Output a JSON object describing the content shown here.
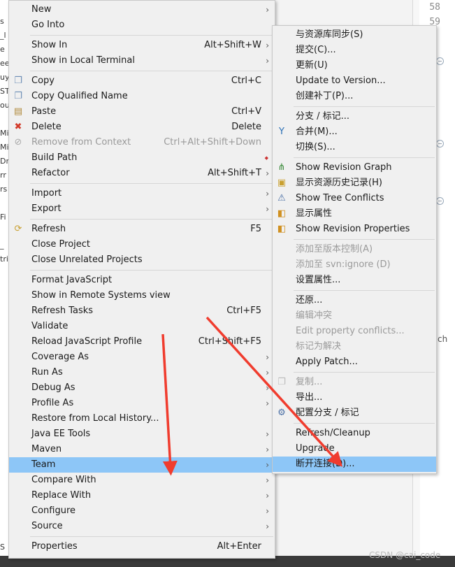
{
  "background": {
    "line_numbers": [
      "58",
      "59"
    ],
    "left_fragments": [
      "s",
      "_l",
      "e",
      "ee",
      "uy",
      "ST",
      "ou",
      "Mi",
      "Mi",
      "Dr",
      "rr",
      "rs",
      "Fi",
      "_",
      "tri",
      "S"
    ],
    "watermark": "CSDN @cai_code",
    "partial_right_text": "ch"
  },
  "context_menu": {
    "items": [
      {
        "label": "New",
        "submenu": true
      },
      {
        "label": "Go Into"
      },
      {
        "separator": true
      },
      {
        "label": "Show In",
        "accelerator": "Alt+Shift+W",
        "submenu": true
      },
      {
        "label": "Show in Local Terminal",
        "submenu": true
      },
      {
        "separator": true
      },
      {
        "label": "Copy",
        "accelerator": "Ctrl+C",
        "icon": "copy-icon"
      },
      {
        "label": "Copy Qualified Name",
        "icon": "copy-qualified-icon"
      },
      {
        "label": "Paste",
        "accelerator": "Ctrl+V",
        "icon": "paste-icon"
      },
      {
        "label": "Delete",
        "accelerator": "Delete",
        "icon": "delete-icon"
      },
      {
        "label": "Remove from Context",
        "accelerator": "Ctrl+Alt+Shift+Down",
        "disabled": true,
        "icon": "remove-context-icon"
      },
      {
        "label": "Build Path",
        "diamond": true
      },
      {
        "label": "Refactor",
        "accelerator": "Alt+Shift+T",
        "submenu": true
      },
      {
        "separator": true
      },
      {
        "label": "Import",
        "submenu": true
      },
      {
        "label": "Export",
        "submenu": true
      },
      {
        "separator": true
      },
      {
        "label": "Refresh",
        "accelerator": "F5",
        "icon": "refresh-icon"
      },
      {
        "label": "Close Project"
      },
      {
        "label": "Close Unrelated Projects"
      },
      {
        "separator": true
      },
      {
        "label": "Format JavaScript"
      },
      {
        "label": "Show in Remote Systems view"
      },
      {
        "label": "Refresh Tasks",
        "accelerator": "Ctrl+F5"
      },
      {
        "label": "Validate"
      },
      {
        "label": "Reload JavaScript Profile",
        "accelerator": "Ctrl+Shift+F5"
      },
      {
        "label": "Coverage As",
        "submenu": true
      },
      {
        "label": "Run As",
        "submenu": true
      },
      {
        "label": "Debug As",
        "submenu": true
      },
      {
        "label": "Profile As",
        "submenu": true
      },
      {
        "label": "Restore from Local History..."
      },
      {
        "label": "Java EE Tools",
        "submenu": true
      },
      {
        "label": "Maven",
        "submenu": true
      },
      {
        "label": "Team",
        "submenu": true,
        "highlighted": true
      },
      {
        "label": "Compare With",
        "submenu": true
      },
      {
        "label": "Replace With",
        "submenu": true
      },
      {
        "label": "Configure",
        "submenu": true
      },
      {
        "label": "Source",
        "submenu": true
      },
      {
        "separator": true
      },
      {
        "label": "Properties",
        "accelerator": "Alt+Enter"
      }
    ]
  },
  "team_submenu": {
    "items": [
      {
        "label": "与资源库同步(S)"
      },
      {
        "label": "提交(C)..."
      },
      {
        "label": "更新(U)"
      },
      {
        "label": "Update to Version..."
      },
      {
        "label": "创建补丁(P)..."
      },
      {
        "separator": true
      },
      {
        "label": "分支 / 标记..."
      },
      {
        "label": "合并(M)...",
        "icon": "merge-icon"
      },
      {
        "label": "切换(S)..."
      },
      {
        "separator": true
      },
      {
        "label": "Show Revision Graph",
        "icon": "revision-graph-icon"
      },
      {
        "label": "显示资源历史记录(H)",
        "icon": "history-icon"
      },
      {
        "label": "Show Tree Conflicts",
        "icon": "tree-conflicts-icon"
      },
      {
        "label": "显示属性",
        "icon": "properties-icon"
      },
      {
        "label": "Show Revision Properties",
        "icon": "revision-properties-icon"
      },
      {
        "separator": true
      },
      {
        "label": "添加至版本控制(A)",
        "disabled": true
      },
      {
        "label": "添加至 svn:ignore (D)",
        "disabled": true
      },
      {
        "label": "设置属性..."
      },
      {
        "separator": true
      },
      {
        "label": "还原..."
      },
      {
        "label": "编辑冲突",
        "disabled": true
      },
      {
        "label": "Edit property conflicts...",
        "disabled": true
      },
      {
        "label": "标记为解决",
        "disabled": true
      },
      {
        "label": "Apply Patch..."
      },
      {
        "separator": true
      },
      {
        "label": "复制...",
        "disabled": true,
        "icon": "copy-disabled-icon"
      },
      {
        "label": "导出..."
      },
      {
        "label": "配置分支 / 标记",
        "icon": "config-branches-icon"
      },
      {
        "separator": true
      },
      {
        "label": "Refresh/Cleanup"
      },
      {
        "label": "Upgrade"
      },
      {
        "label": "断开连接(D)...",
        "highlighted": true
      }
    ]
  },
  "colors": {
    "highlight": "#8dc6f7",
    "arrow": "#f03c2e",
    "disabled_text": "#9a9a9a"
  }
}
